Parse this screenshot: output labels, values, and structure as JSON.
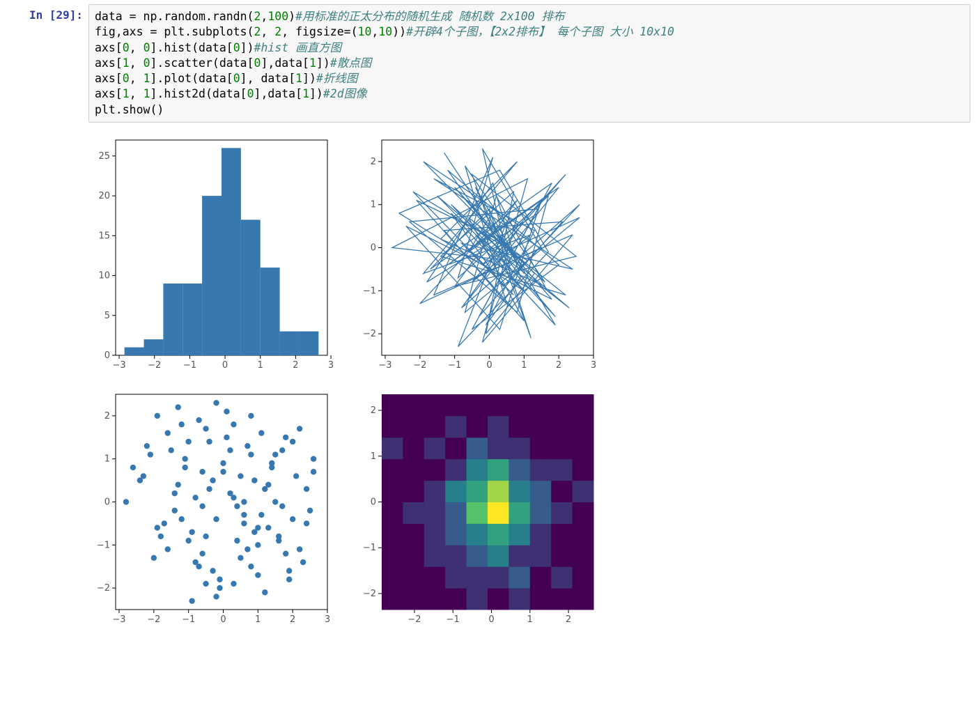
{
  "cell": {
    "prompt_prefix": "In [",
    "prompt_number": "29",
    "prompt_suffix": "]:",
    "code_tokens": [
      {
        "t": "data = np.random.randn(",
        "c": ""
      },
      {
        "t": "2",
        "c": "num"
      },
      {
        "t": ",",
        "c": ""
      },
      {
        "t": "100",
        "c": "num"
      },
      {
        "t": ")",
        "c": ""
      },
      {
        "t": "#用标准的正太分布的随机生成 随机数 2x100 排布",
        "c": "cmt"
      },
      {
        "t": "\n",
        "c": ""
      },
      {
        "t": "fig,axs = plt.subplots(",
        "c": ""
      },
      {
        "t": "2",
        "c": "num"
      },
      {
        "t": ", ",
        "c": ""
      },
      {
        "t": "2",
        "c": "num"
      },
      {
        "t": ", figsize=(",
        "c": ""
      },
      {
        "t": "10",
        "c": "num"
      },
      {
        "t": ",",
        "c": ""
      },
      {
        "t": "10",
        "c": "num"
      },
      {
        "t": "))",
        "c": ""
      },
      {
        "t": "#开辟4个子图，【2x2排布】 每个子图 大小 10x10",
        "c": "cmt"
      },
      {
        "t": "\n",
        "c": ""
      },
      {
        "t": "axs[",
        "c": ""
      },
      {
        "t": "0",
        "c": "num"
      },
      {
        "t": ", ",
        "c": ""
      },
      {
        "t": "0",
        "c": "num"
      },
      {
        "t": "].hist(data[",
        "c": ""
      },
      {
        "t": "0",
        "c": "num"
      },
      {
        "t": "])",
        "c": ""
      },
      {
        "t": "#hist 画直方图",
        "c": "cmt"
      },
      {
        "t": "\n",
        "c": ""
      },
      {
        "t": "axs[",
        "c": ""
      },
      {
        "t": "1",
        "c": "num"
      },
      {
        "t": ", ",
        "c": ""
      },
      {
        "t": "0",
        "c": "num"
      },
      {
        "t": "].scatter(data[",
        "c": ""
      },
      {
        "t": "0",
        "c": "num"
      },
      {
        "t": "],data[",
        "c": ""
      },
      {
        "t": "1",
        "c": "num"
      },
      {
        "t": "])",
        "c": ""
      },
      {
        "t": "#散点图",
        "c": "cmt"
      },
      {
        "t": "\n",
        "c": ""
      },
      {
        "t": "axs[",
        "c": ""
      },
      {
        "t": "0",
        "c": "num"
      },
      {
        "t": ", ",
        "c": ""
      },
      {
        "t": "1",
        "c": "num"
      },
      {
        "t": "].plot(data[",
        "c": ""
      },
      {
        "t": "0",
        "c": "num"
      },
      {
        "t": "], data[",
        "c": ""
      },
      {
        "t": "1",
        "c": "num"
      },
      {
        "t": "])",
        "c": ""
      },
      {
        "t": "#折线图",
        "c": "cmt"
      },
      {
        "t": "\n",
        "c": ""
      },
      {
        "t": "axs[",
        "c": ""
      },
      {
        "t": "1",
        "c": "num"
      },
      {
        "t": ", ",
        "c": ""
      },
      {
        "t": "1",
        "c": "num"
      },
      {
        "t": "].hist2d(data[",
        "c": ""
      },
      {
        "t": "0",
        "c": "num"
      },
      {
        "t": "],data[",
        "c": ""
      },
      {
        "t": "1",
        "c": "num"
      },
      {
        "t": "])",
        "c": ""
      },
      {
        "t": "#2d图像",
        "c": "cmt"
      },
      {
        "t": "\n",
        "c": ""
      },
      {
        "t": "plt.show()",
        "c": ""
      }
    ]
  },
  "chart_data": [
    {
      "type": "bar",
      "position": "top-left",
      "description": "histogram of data[0]",
      "x_ticks": [
        -3,
        -2,
        -1,
        0,
        1,
        2,
        3
      ],
      "y_ticks": [
        0,
        5,
        10,
        15,
        20,
        25
      ],
      "xlim": [
        -3.1,
        2.9
      ],
      "ylim": [
        0,
        27
      ],
      "bins": [
        {
          "xstart": -2.85,
          "xend": -2.3,
          "count": 1
        },
        {
          "xstart": -2.3,
          "xend": -1.75,
          "count": 2
        },
        {
          "xstart": -1.75,
          "xend": -1.2,
          "count": 9
        },
        {
          "xstart": -1.2,
          "xend": -0.65,
          "count": 9
        },
        {
          "xstart": -0.65,
          "xend": -0.1,
          "count": 20
        },
        {
          "xstart": -0.1,
          "xend": 0.45,
          "count": 26
        },
        {
          "xstart": 0.45,
          "xend": 1.0,
          "count": 17
        },
        {
          "xstart": 1.0,
          "xend": 1.55,
          "count": 11
        },
        {
          "xstart": 1.55,
          "xend": 2.1,
          "count": 3
        },
        {
          "xstart": 2.1,
          "xend": 2.65,
          "count": 3
        }
      ]
    },
    {
      "type": "line",
      "position": "top-right",
      "description": "plot of (data[0], data[1]) connected in sequence",
      "x_ticks": [
        -3,
        -2,
        -1,
        0,
        1,
        2,
        3
      ],
      "y_ticks": [
        -2,
        -1,
        0,
        1,
        2
      ],
      "xlim": [
        -3.1,
        3.0
      ],
      "ylim": [
        -2.5,
        2.5
      ],
      "points": [
        [
          0.3,
          0.1
        ],
        [
          -1.2,
          1.8
        ],
        [
          2.0,
          -0.4
        ],
        [
          -0.5,
          -1.9
        ],
        [
          1.4,
          0.9
        ],
        [
          -2.3,
          0.6
        ],
        [
          0.8,
          -1.5
        ],
        [
          1.7,
          1.2
        ],
        [
          -0.9,
          -0.7
        ],
        [
          0.1,
          2.1
        ],
        [
          -1.6,
          -1.1
        ],
        [
          2.4,
          0.3
        ],
        [
          -0.2,
          -2.2
        ],
        [
          1.1,
          1.6
        ],
        [
          -2.8,
          0.0
        ],
        [
          0.6,
          -0.3
        ],
        [
          -0.4,
          1.4
        ],
        [
          1.9,
          -1.8
        ],
        [
          -1.1,
          0.8
        ],
        [
          0.4,
          -0.9
        ],
        [
          2.6,
          1.0
        ],
        [
          -0.8,
          -1.4
        ],
        [
          0.9,
          0.5
        ],
        [
          -1.9,
          2.0
        ],
        [
          1.3,
          -0.6
        ],
        [
          -0.1,
          -2.0
        ],
        [
          0.7,
          1.3
        ],
        [
          -1.4,
          -0.2
        ],
        [
          2.2,
          -1.1
        ],
        [
          -0.6,
          0.7
        ],
        [
          1.0,
          -1.7
        ],
        [
          -2.1,
          1.1
        ],
        [
          0.2,
          0.2
        ],
        [
          1.6,
          -0.8
        ],
        [
          -0.7,
          1.9
        ],
        [
          0.5,
          -1.3
        ],
        [
          -1.3,
          0.4
        ],
        [
          2.1,
          0.6
        ],
        [
          -0.3,
          -1.6
        ],
        [
          1.8,
          1.5
        ],
        [
          -1.7,
          -0.5
        ],
        [
          0.0,
          0.9
        ],
        [
          1.2,
          -2.1
        ],
        [
          -0.5,
          1.7
        ],
        [
          2.5,
          -0.2
        ],
        [
          -1.0,
          -0.9
        ],
        [
          0.8,
          1.1
        ],
        [
          -2.0,
          -1.3
        ],
        [
          1.5,
          0.0
        ],
        [
          -0.2,
          2.3
        ],
        [
          0.6,
          -0.5
        ],
        [
          -1.5,
          1.2
        ],
        [
          2.3,
          -1.4
        ],
        [
          -0.4,
          0.3
        ],
        [
          1.0,
          -1.0
        ],
        [
          -2.6,
          0.8
        ],
        [
          0.3,
          1.8
        ],
        [
          1.7,
          -0.1
        ],
        [
          -0.9,
          -2.3
        ],
        [
          0.5,
          0.6
        ],
        [
          -1.2,
          -0.4
        ],
        [
          2.0,
          1.4
        ],
        [
          -0.6,
          -1.2
        ],
        [
          1.4,
          0.8
        ],
        [
          -1.8,
          -0.8
        ],
        [
          0.1,
          1.5
        ],
        [
          0.9,
          -0.7
        ],
        [
          -0.1,
          -1.8
        ],
        [
          1.3,
          0.4
        ],
        [
          -1.6,
          1.6
        ],
        [
          2.4,
          -0.5
        ],
        [
          -0.8,
          0.1
        ],
        [
          0.7,
          -1.1
        ],
        [
          -2.2,
          1.3
        ],
        [
          1.1,
          -0.3
        ],
        [
          -0.3,
          0.5
        ],
        [
          1.9,
          -1.6
        ],
        [
          -1.1,
          1.0
        ],
        [
          0.4,
          -0.1
        ],
        [
          2.6,
          0.7
        ],
        [
          -0.7,
          -1.5
        ],
        [
          0.2,
          1.2
        ],
        [
          1.6,
          -0.9
        ],
        [
          -1.4,
          0.2
        ],
        [
          0.8,
          2.0
        ],
        [
          -1.9,
          -0.6
        ],
        [
          1.2,
          0.3
        ],
        [
          -0.5,
          -0.8
        ],
        [
          2.2,
          1.7
        ],
        [
          -0.2,
          -0.4
        ],
        [
          0.6,
          0.0
        ],
        [
          -1.0,
          1.4
        ],
        [
          1.8,
          -1.2
        ],
        [
          -2.4,
          0.5
        ],
        [
          0.3,
          -1.9
        ],
        [
          1.5,
          1.1
        ],
        [
          -0.6,
          -0.1
        ],
        [
          0.0,
          0.7
        ],
        [
          1.0,
          -0.6
        ],
        [
          -1.3,
          2.2
        ]
      ]
    },
    {
      "type": "scatter",
      "position": "bottom-left",
      "description": "scatter of (data[0], data[1])",
      "x_ticks": [
        -3,
        -2,
        -1,
        0,
        1,
        2,
        3
      ],
      "y_ticks": [
        -2,
        -1,
        0,
        1,
        2
      ],
      "xlim": [
        -3.1,
        3.0
      ],
      "ylim": [
        -2.5,
        2.5
      ]
    },
    {
      "type": "heatmap",
      "position": "bottom-right",
      "description": "hist2d of (data[0], data[1])",
      "x_ticks": [
        -2,
        -1,
        0,
        1,
        2
      ],
      "y_ticks": [
        -2,
        -1,
        0,
        1,
        2
      ],
      "xlim": [
        -2.85,
        2.65
      ],
      "ylim": [
        -2.35,
        2.35
      ],
      "nx": 10,
      "ny": 10,
      "counts_rows_bottom_to_top": [
        [
          0,
          0,
          0,
          0,
          1,
          0,
          1,
          0,
          0,
          0
        ],
        [
          0,
          0,
          0,
          1,
          1,
          1,
          2,
          0,
          1,
          0
        ],
        [
          0,
          0,
          1,
          1,
          2,
          3,
          1,
          1,
          0,
          0
        ],
        [
          0,
          0,
          1,
          2,
          3,
          4,
          3,
          1,
          0,
          0
        ],
        [
          0,
          1,
          1,
          2,
          5,
          7,
          4,
          2,
          1,
          0
        ],
        [
          0,
          0,
          1,
          3,
          4,
          6,
          3,
          2,
          0,
          1
        ],
        [
          0,
          0,
          0,
          1,
          3,
          4,
          2,
          1,
          1,
          0
        ],
        [
          1,
          0,
          1,
          0,
          2,
          1,
          1,
          0,
          0,
          0
        ],
        [
          0,
          0,
          0,
          1,
          0,
          1,
          0,
          0,
          0,
          0
        ],
        [
          0,
          0,
          0,
          0,
          0,
          0,
          0,
          0,
          0,
          0
        ]
      ],
      "colormap": "viridis"
    }
  ]
}
